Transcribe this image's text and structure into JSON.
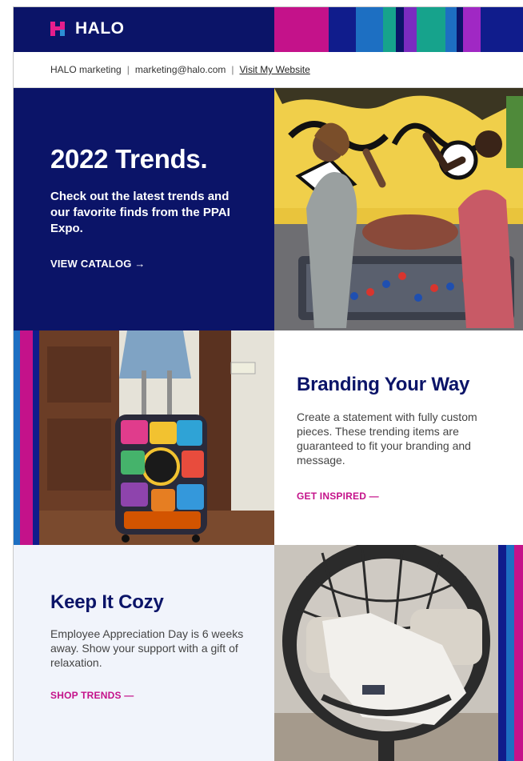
{
  "brand": {
    "name": "HALO",
    "colors": {
      "navy": "#0b1468",
      "magenta": "#c4128a",
      "teal": "#16a38c",
      "blue": "#1d6fc2",
      "purple": "#7a2bc0"
    }
  },
  "contact": {
    "company": "HALO marketing",
    "email": "marketing@halo.com",
    "website_link": "Visit My Website",
    "separator": "|"
  },
  "hero": {
    "title": "2022 Trends.",
    "body": "Check out the latest trends and our favorite finds from the PPAI Expo.",
    "cta": "VIEW CATALOG →"
  },
  "branding": {
    "title": "Branding Your Way",
    "body": "Create a statement with fully custom pieces. These trending items are guaranteed to fit your branding and message.",
    "cta": "GET INSPIRED —"
  },
  "cozy": {
    "title": "Keep It Cozy",
    "body": "Employee Appreciation Day is 6 weeks away. Show your support with a gift of relaxation.",
    "cta": "SHOP TRENDS —"
  },
  "images": {
    "hero": "foosball-high-five-photo",
    "luggage": "sticker-suitcase-photo",
    "chair": "hanging-egg-chair-photo"
  }
}
